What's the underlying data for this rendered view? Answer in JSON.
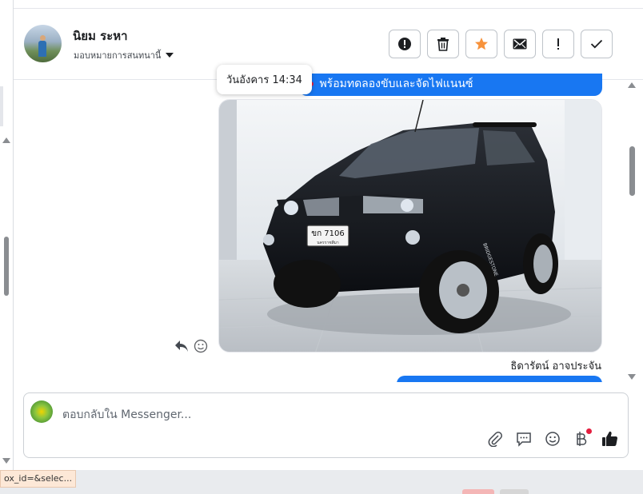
{
  "header": {
    "contact_name": "นิยม ระหา",
    "assign_label": "มอบหมายการสนทนานี้"
  },
  "actions": [
    {
      "name": "spam-button",
      "icon": "alert-circle-icon"
    },
    {
      "name": "delete-button",
      "icon": "trash-icon"
    },
    {
      "name": "star-button",
      "icon": "star-icon",
      "color": "#f7923b"
    },
    {
      "name": "mark-unread-button",
      "icon": "envelope-icon"
    },
    {
      "name": "follow-up-button",
      "icon": "exclamation-icon"
    },
    {
      "name": "done-button",
      "icon": "checkmark-icon"
    }
  ],
  "conversation": {
    "timestamp": "วันอังคาร 14:34",
    "top_bubble_text": "พร้อมทดลองขับและจัดไฟแนนซ์",
    "photo": {
      "plate_text": "ขก 7106",
      "plate_province": "นครราชสีมา",
      "tyre_text": "BRIDGESTONE"
    },
    "sender_name": "ธิดารัตน์ อาจประจัน"
  },
  "composer": {
    "placeholder": "ตอบกลับใน Messenger...",
    "tools": [
      "paperclip-icon",
      "saved-reply-icon",
      "emoji-icon",
      "baht-icon",
      "thumbs-up-icon"
    ]
  },
  "status_bar": {
    "url_text": "ox_id=&selec..."
  },
  "colors": {
    "messenger_blue": "#1877f2",
    "star_orange": "#f7923b",
    "notification_red": "#e41e3f"
  }
}
